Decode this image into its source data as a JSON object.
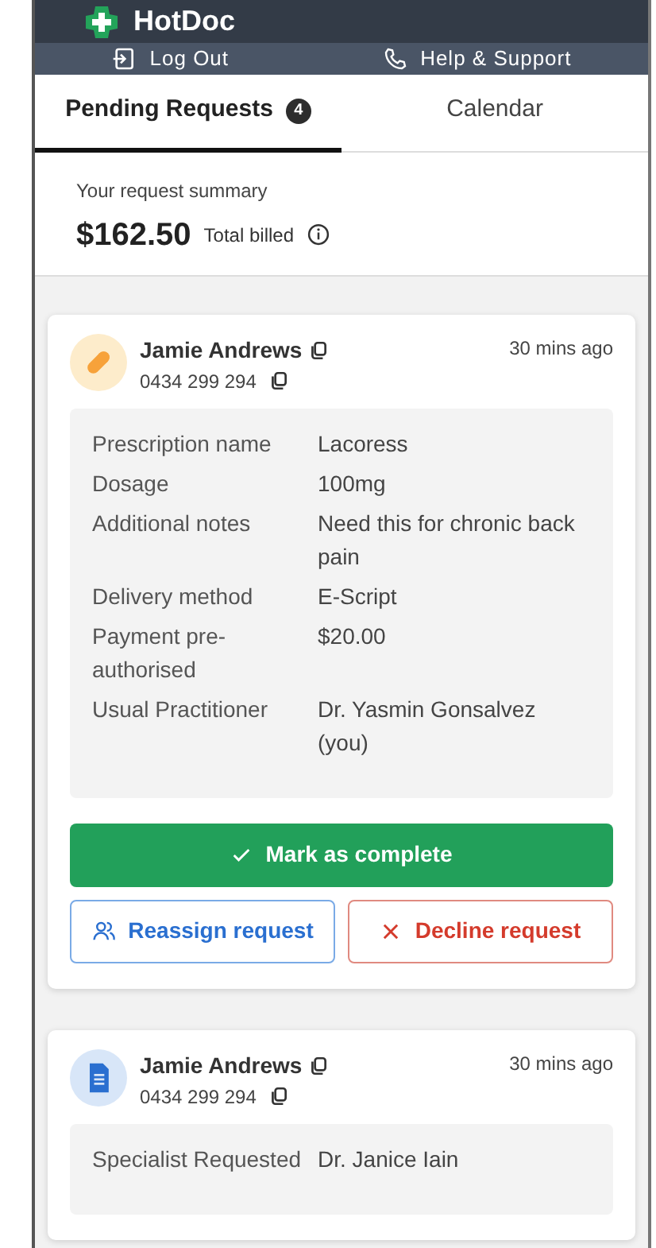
{
  "app": {
    "brand": "HotDoc"
  },
  "nav_links": [
    {
      "kind": "logout",
      "label": "Log Out"
    },
    {
      "kind": "help",
      "label": "Help & Support"
    }
  ],
  "tabs": [
    {
      "label": "Pending Requests",
      "badge": "4",
      "selected": true
    },
    {
      "label": "Calendar",
      "selected": false
    }
  ],
  "summary": {
    "title": "Your request summary",
    "amount": "$162.50",
    "amount_label": "Total billed"
  },
  "requests": [
    {
      "kind": "prescription",
      "patient": "Jamie Andrews",
      "phone": "0434 299 294",
      "time": "30 mins ago",
      "details": [
        {
          "label": "Prescription name",
          "value": "Lacoress"
        },
        {
          "label": "Dosage",
          "value": "100mg"
        },
        {
          "label": "Additional notes",
          "value": "Need this for chronic back pain"
        },
        {
          "label": "Delivery method",
          "value": "E-Script"
        },
        {
          "label": "Payment pre-authorised",
          "value": "$20.00"
        },
        {
          "label": "Usual Practitioner",
          "value": "Dr. Yasmin Gonsalvez (you)"
        }
      ],
      "actions": {
        "complete": "Mark as complete",
        "reassign": "Reassign request",
        "decline": "Decline request"
      }
    },
    {
      "kind": "referral",
      "patient": "Jamie Andrews",
      "phone": "0434 299 294",
      "time": "30 mins ago",
      "details": [
        {
          "label": "Specialist Requested",
          "value": "Dr. Janice Iain"
        }
      ]
    }
  ]
}
